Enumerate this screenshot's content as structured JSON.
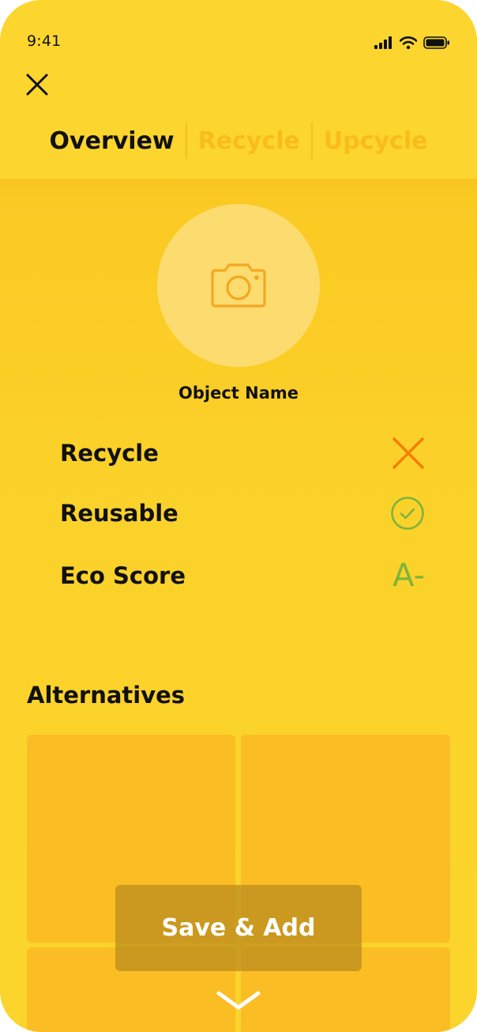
{
  "status_bar": {
    "time": "9:41",
    "icons": [
      "signal-icon",
      "wifi-icon",
      "battery-icon"
    ]
  },
  "header": {
    "close_icon": "close-icon",
    "tabs": [
      {
        "label": "Overview",
        "active": true
      },
      {
        "label": "Recycle",
        "active": false
      },
      {
        "label": "Upcycle",
        "active": false
      }
    ]
  },
  "object": {
    "photo_icon": "camera-icon",
    "name": "Object Name"
  },
  "attributes": [
    {
      "label": "Recycle",
      "icon": "cross-icon",
      "color": "#f57c00"
    },
    {
      "label": "Reusable",
      "icon": "check-circle-icon",
      "color": "#7fb33c"
    },
    {
      "label": "Eco Score",
      "value": "A-",
      "color": "#7fb33c"
    }
  ],
  "alternatives": {
    "title": "Alternatives",
    "card_count": 4
  },
  "actions": {
    "save_label": "Save & Add",
    "expand_icon": "chevron-down-icon"
  },
  "colors": {
    "background": "#fbd22e",
    "accent_orange": "#f5a623",
    "inactive_tab": "#f9bc1a",
    "card": "#fbbd24"
  }
}
